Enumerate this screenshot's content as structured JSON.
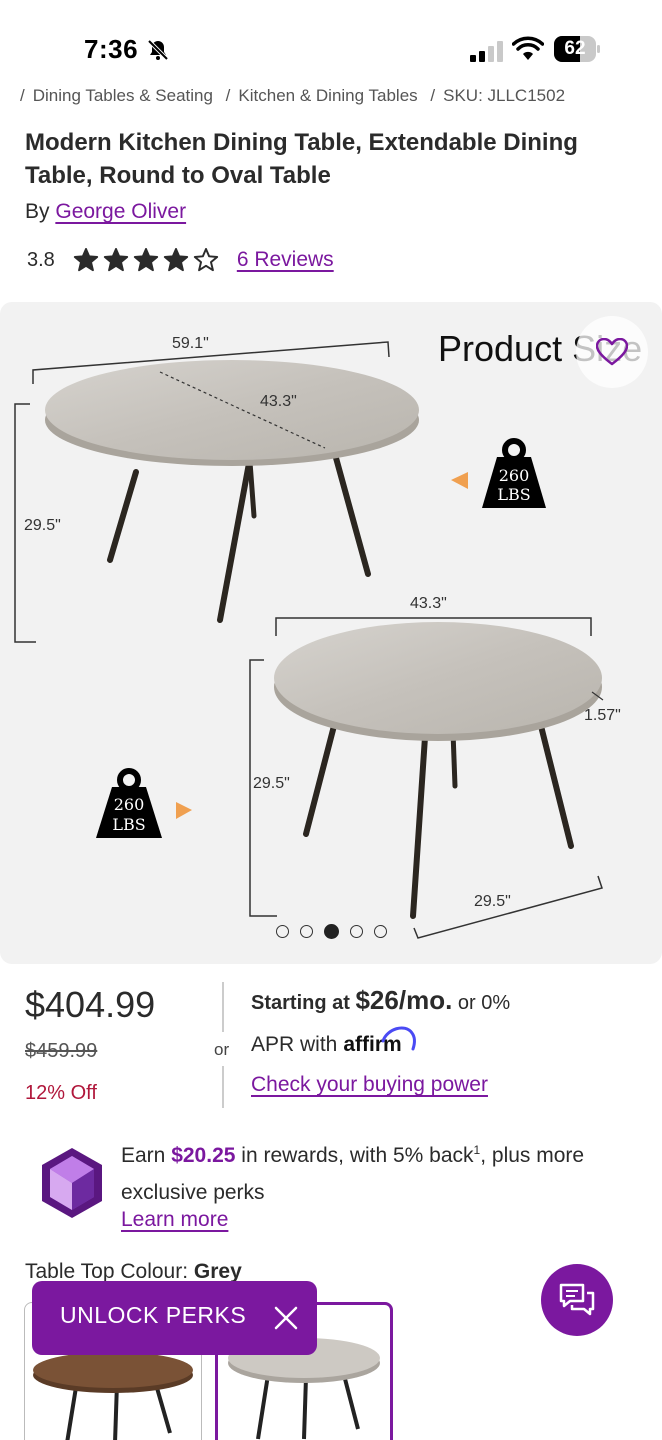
{
  "status_bar": {
    "time": "7:36",
    "battery": "62",
    "battery_level": 0.62
  },
  "breadcrumb": [
    "Dining Tables & Seating",
    "Kitchen & Dining Tables",
    "SKU: JLLC1502"
  ],
  "product": {
    "title": "Modern Kitchen Dining Table, Extendable Dining Table, Round to Oval Table",
    "by_label": "By",
    "brand": "George Oliver",
    "rating": "3.8",
    "rating_value": 3.8,
    "reviews_link": "6 Reviews"
  },
  "gallery": {
    "caption": "Product Size",
    "dim_oval_length": "59.1\"",
    "dim_oval_width": "43.3\"",
    "dim_height_1": "29.5\"",
    "weight_1_num": "260",
    "weight_1_unit": "LBS",
    "dim_round_diameter": "43.3\"",
    "dim_thickness": "1.57\"",
    "dim_height_2": "29.5\"",
    "dim_leg_spread": "29.5\"",
    "weight_2_num": "260",
    "weight_2_unit": "LBS",
    "slide_count": 5,
    "active_slide": 3
  },
  "pricing": {
    "price": "$404.99",
    "original_price": "$459.99",
    "discount": "12% Off",
    "or_label": "or",
    "starting_at": "Starting at",
    "monthly": "$26/mo.",
    "or_zero": "or 0%",
    "apr_with": "APR with",
    "affirm": "affirm",
    "buying_power_link": "Check your buying power"
  },
  "rewards": {
    "earn": "Earn",
    "amount": "$20.25",
    "text_rest": "in rewards, with 5% back",
    "sup": "1",
    "text_tail": ", plus more exclusive perks",
    "learn_more": "Learn more"
  },
  "options": {
    "label": "Table Top Colour:",
    "selected": "Grey"
  },
  "unlock_perks": {
    "label": "UNLOCK PERKS"
  },
  "colors": {
    "brand_purple": "#7b189f",
    "discount_red": "#b0173b",
    "weight_arrow": "#f0a050"
  },
  "icons": [
    "bell-off-icon",
    "signal-icon",
    "wifi-icon",
    "battery-icon",
    "star-icon",
    "star-outline-icon",
    "heart-icon",
    "gem-icon",
    "close-icon",
    "chat-icon"
  ]
}
